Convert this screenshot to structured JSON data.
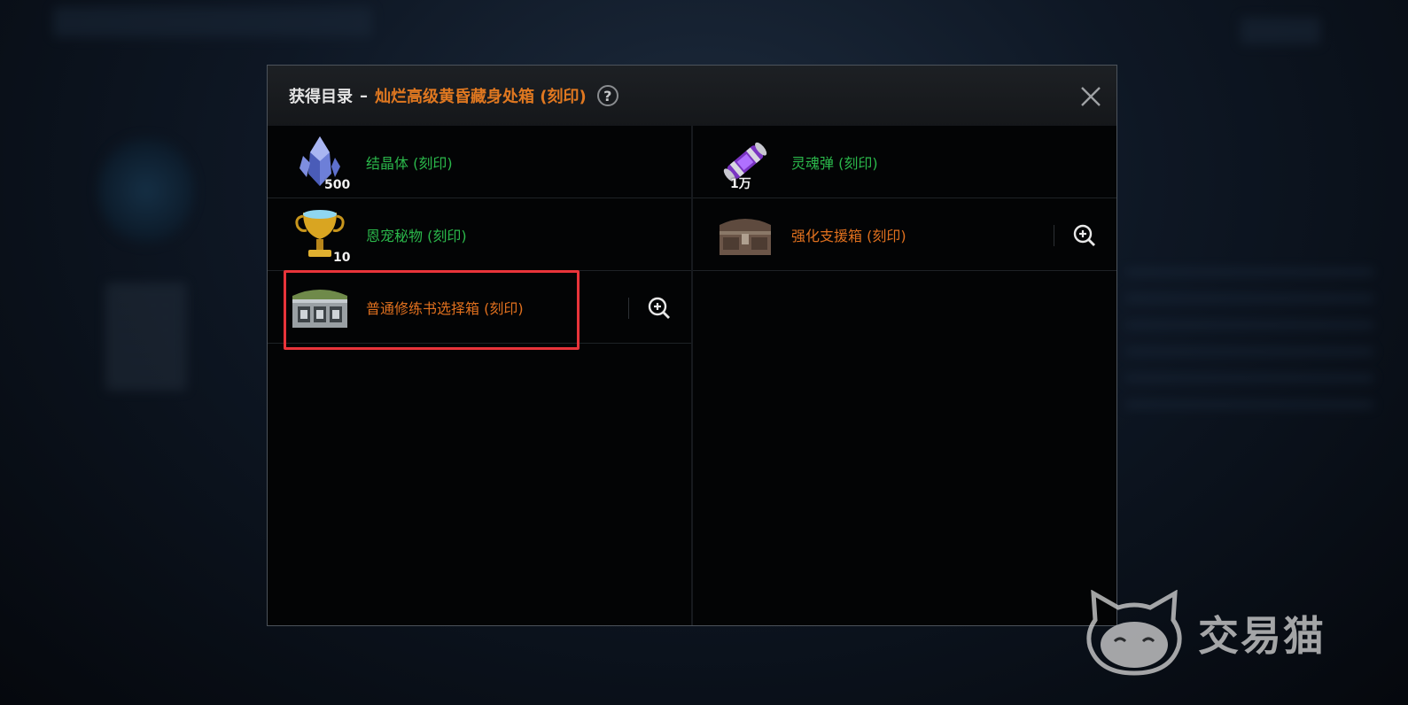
{
  "dialog": {
    "title_prefix": "获得目录",
    "title_separator": "–",
    "title_item": "灿烂高级黄昏藏身处箱 (刻印)",
    "help_symbol": "?",
    "title_item_color": "#e07820"
  },
  "items": [
    {
      "name": "结晶体 (刻印)",
      "quantity": "500",
      "color": "green",
      "icon": "crystal-icon"
    },
    {
      "name": "灵魂弹 (刻印)",
      "quantity": "1万",
      "color": "green",
      "icon": "soul-bullet-icon"
    },
    {
      "name": "恩宠秘物 (刻印)",
      "quantity": "10",
      "color": "green",
      "icon": "trophy-icon"
    },
    {
      "name": "强化支援箱 (刻印)",
      "quantity": "",
      "color": "orange",
      "icon": "chest-icon"
    },
    {
      "name": "普通修练书选择箱 (刻印)",
      "quantity": "",
      "color": "orange",
      "icon": "book-chest-icon"
    }
  ],
  "colors": {
    "green": "#2bb84b",
    "orange": "#e0701e",
    "highlight": "#e8343a"
  },
  "watermark": {
    "text": "交易猫"
  }
}
